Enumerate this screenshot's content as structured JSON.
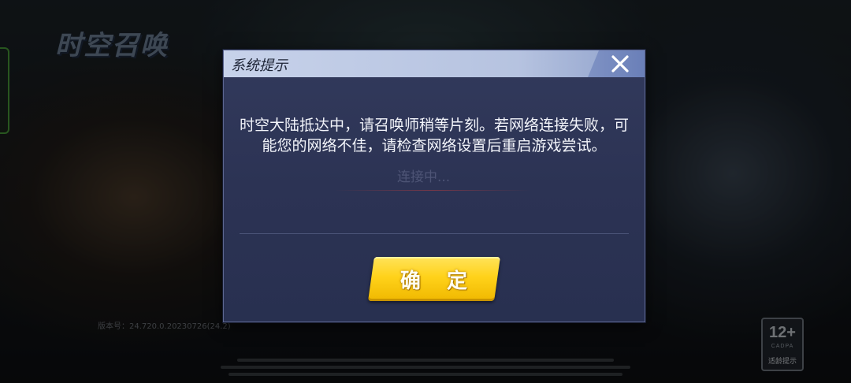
{
  "background": {
    "logo_text": "时空召唤",
    "version_text": "版本号：24.720.0.20230726(24.2)",
    "age_badge": {
      "rating": "12+",
      "org": "CADPA",
      "label": "适龄提示"
    }
  },
  "dialog": {
    "title": "系统提示",
    "close_icon": "close-icon",
    "message": "时空大陆抵达中，请召唤师稍等片刻。若网络连接失败，可能您的网络不佳，请检查网络设置后重启游戏尝试。",
    "underlying_text": "连接中...",
    "confirm_label": "确 定"
  },
  "colors": {
    "dialog_bg": "#2c3354",
    "titlebar": "#c7d2ea",
    "confirm": "#ffd21a"
  }
}
